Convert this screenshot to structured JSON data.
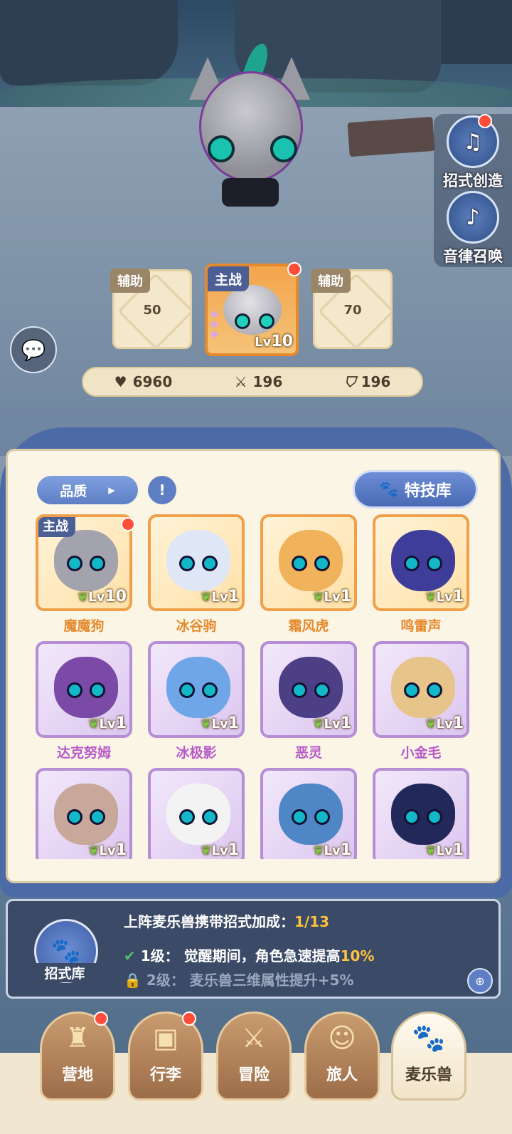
{
  "side_buttons": [
    {
      "label": "招式创造",
      "icon": "music-box-icon",
      "has_dot": true
    },
    {
      "label": "音律召唤",
      "icon": "lyre-icon",
      "has_dot": false
    }
  ],
  "team": {
    "left": {
      "tag": "辅助",
      "value": "50"
    },
    "main": {
      "tag": "主战",
      "lv_prefix": "Lv",
      "lv": "10"
    },
    "right": {
      "tag": "辅助",
      "value": "70"
    }
  },
  "stats": {
    "hp": "6960",
    "attack": "196",
    "defense": "196"
  },
  "filter": {
    "label": "品质",
    "book_icon": "!"
  },
  "skill_lib_button": "特技库",
  "monsters": [
    {
      "name": "魔魔狗",
      "lv": "10",
      "rarity": "gold",
      "tag": "主战",
      "color": "#a3a3ad"
    },
    {
      "name": "冰谷驹",
      "lv": "1",
      "rarity": "gold",
      "tag": "",
      "color": "#dfe6f5"
    },
    {
      "name": "霜风虎",
      "lv": "1",
      "rarity": "gold",
      "tag": "",
      "color": "#f0b25a"
    },
    {
      "name": "鸣雷声",
      "lv": "1",
      "rarity": "gold",
      "tag": "",
      "color": "#3e3e9a"
    },
    {
      "name": "达克努姆",
      "lv": "1",
      "rarity": "purple",
      "tag": "",
      "color": "#7a4aa6"
    },
    {
      "name": "冰极影",
      "lv": "1",
      "rarity": "purple",
      "tag": "",
      "color": "#6ea6e8"
    },
    {
      "name": "恶灵",
      "lv": "1",
      "rarity": "purple",
      "tag": "",
      "color": "#4d3f86"
    },
    {
      "name": "小金毛",
      "lv": "1",
      "rarity": "purple",
      "tag": "",
      "color": "#e6c48a"
    },
    {
      "name": "",
      "lv": "1",
      "rarity": "purple",
      "tag": "",
      "color": "#c7a89a"
    },
    {
      "name": "",
      "lv": "1",
      "rarity": "purple",
      "tag": "",
      "color": "#f3f3f3"
    },
    {
      "name": "",
      "lv": "1",
      "rarity": "purple",
      "tag": "",
      "color": "#4f86c6"
    },
    {
      "name": "",
      "lv": "1",
      "rarity": "purple",
      "tag": "",
      "color": "#23285a"
    }
  ],
  "info": {
    "icon_label": "招式库",
    "title": "上阵麦乐兽携带招式加成：",
    "progress": "1/13",
    "line1_prefix": "1级：",
    "line1_text": "觉醒期间，角色急速提高",
    "line1_value": "10%",
    "line2_prefix": "2级：",
    "line2_text": "麦乐兽三维属性提升+5%"
  },
  "tabs": [
    {
      "label": "营地",
      "icon": "castle-icon",
      "has_dot": true,
      "active": false
    },
    {
      "label": "行李",
      "icon": "chest-icon",
      "has_dot": true,
      "active": false
    },
    {
      "label": "冒险",
      "icon": "swords-icon",
      "has_dot": false,
      "active": false
    },
    {
      "label": "旅人",
      "icon": "traveler-icon",
      "has_dot": false,
      "active": false
    },
    {
      "label": "麦乐兽",
      "icon": "melody-beast-icon",
      "has_dot": false,
      "active": true
    }
  ],
  "lv_prefix": "Lv"
}
